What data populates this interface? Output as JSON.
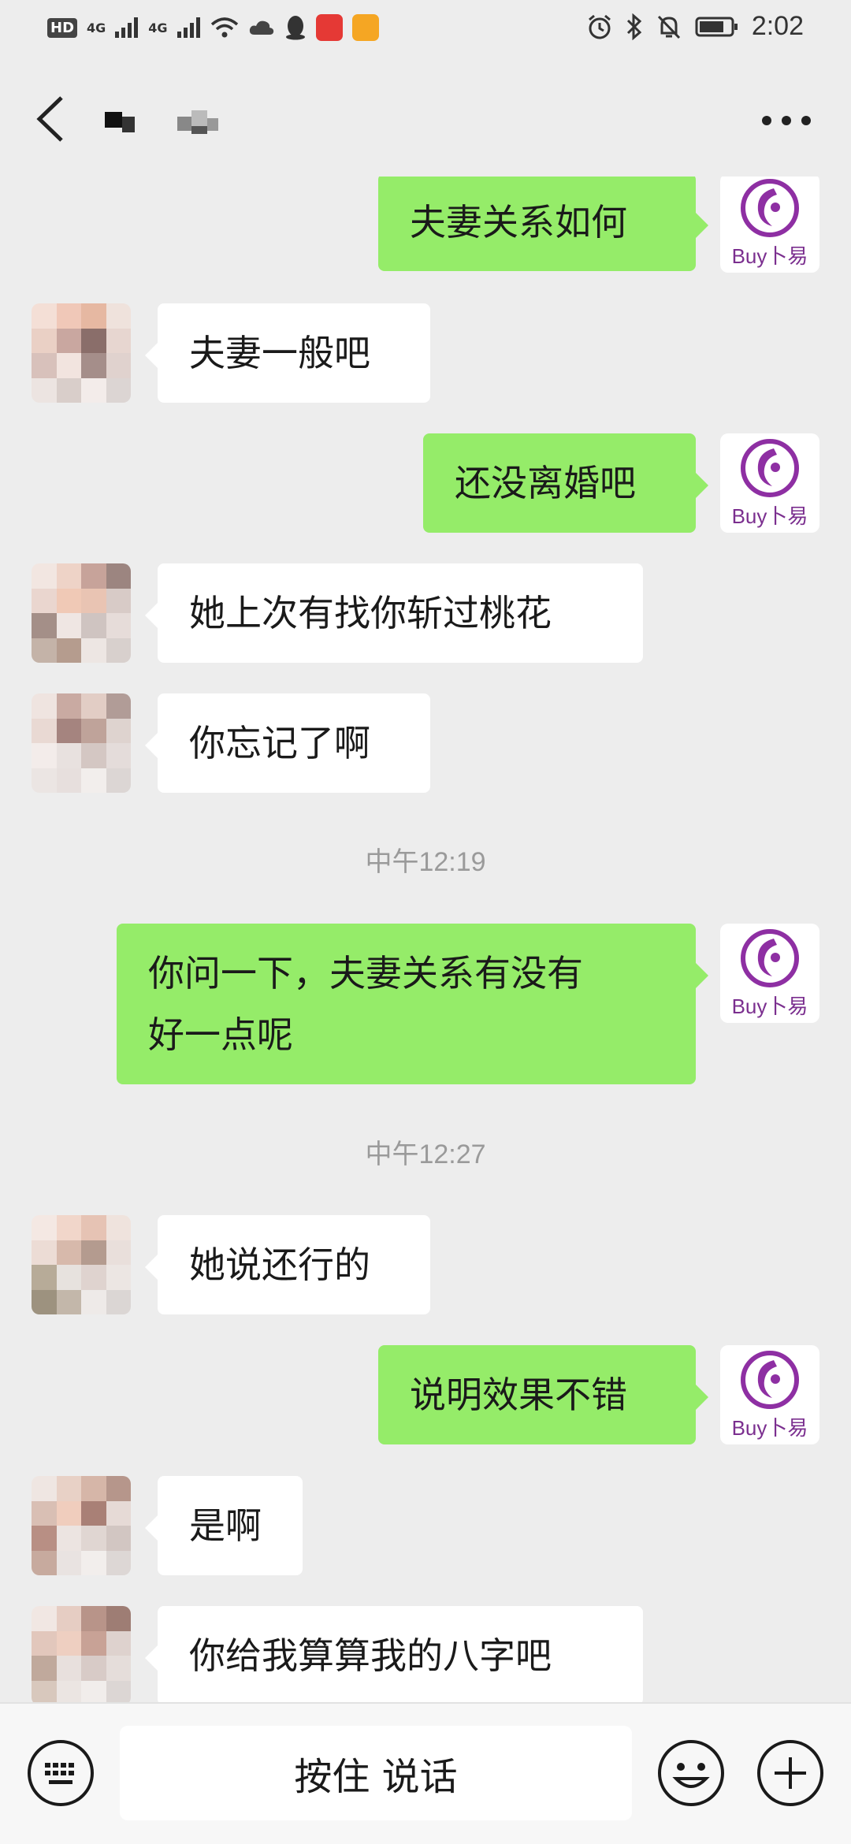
{
  "status_bar": {
    "hd_label": "HD",
    "net_1": "4G",
    "net_2": "4G",
    "time": "2:02"
  },
  "header": {
    "back_icon": "chevron-left-icon",
    "more_icon": "more-dots-icon"
  },
  "colors": {
    "background": "#ededed",
    "outgoing_bubble": "#95ec69",
    "incoming_bubble": "#ffffff",
    "brand_purple": "#7b2f8f"
  },
  "brand_avatar_text": "Buy卜易",
  "messages": [
    {
      "dir": "out",
      "text": "夫妻关系如何"
    },
    {
      "dir": "in",
      "text": "夫妻一般吧"
    },
    {
      "dir": "out",
      "text": "还没离婚吧"
    },
    {
      "dir": "in",
      "text": "她上次有找你斩过桃花"
    },
    {
      "dir": "in",
      "text": "你忘记了啊"
    },
    {
      "type": "time",
      "text": "中午12:19"
    },
    {
      "dir": "out",
      "line1": "你问一下，夫妻关系有没有",
      "line2": "好一点呢"
    },
    {
      "type": "time",
      "text": "中午12:27"
    },
    {
      "dir": "in",
      "text": "她说还行的"
    },
    {
      "dir": "out",
      "text": "说明效果不错"
    },
    {
      "dir": "in",
      "text": "是啊"
    },
    {
      "dir": "in",
      "text": "你给我算算我的八字吧"
    }
  ],
  "input_bar": {
    "keyboard_icon": "keyboard-icon",
    "voice_label": "按住 说话",
    "emoji_icon": "emoji-icon",
    "plus_icon": "plus-icon"
  }
}
